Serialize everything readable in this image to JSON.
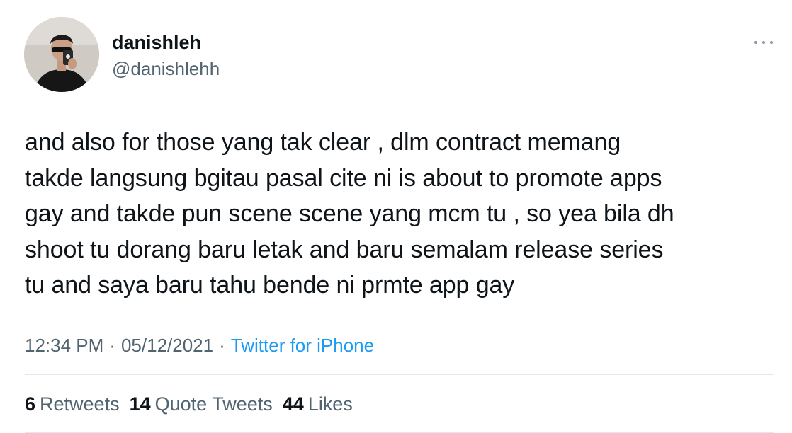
{
  "author": {
    "display_name": "danishleh",
    "handle": "@danishlehh"
  },
  "tweet": {
    "text": "and also for those yang tak clear , dlm contract memang\ntakde langsung bgitau pasal cite ni is about to promote apps\ngay and takde pun scene scene yang mcm tu , so yea bila dh\nshoot tu dorang baru letak and baru semalam release series\ntu and saya baru tahu bende ni prmte app gay"
  },
  "meta": {
    "time": "12:34 PM",
    "date": "05/12/2021",
    "separator": "·",
    "source": "Twitter for iPhone"
  },
  "stats": {
    "retweets_count": "6",
    "retweets_label": "Retweets",
    "quotes_count": "14",
    "quotes_label": "Quote Tweets",
    "likes_count": "44",
    "likes_label": "Likes"
  },
  "icons": {
    "more": "more-horizontal-icon"
  },
  "colors": {
    "text_primary": "#0f1419",
    "text_secondary": "#536471",
    "link": "#1d9bf0",
    "divider": "#e1e8ed"
  }
}
